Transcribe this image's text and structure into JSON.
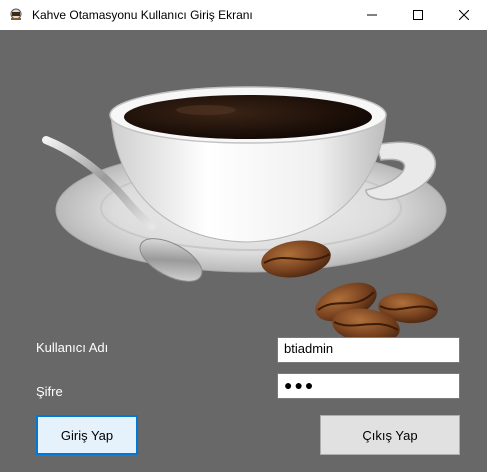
{
  "window": {
    "title": "Kahve Otamasyonu Kullanıcı Giriş Ekranı"
  },
  "login": {
    "username_label": "Kullanıcı Adı",
    "username_value": "btiadmin",
    "password_label": "Şifre",
    "password_masked": "●●●",
    "login_button": "Giriş Yap",
    "exit_button": "Çıkış Yap"
  },
  "colors": {
    "background": "#686868",
    "primary_border": "#0078d7"
  }
}
